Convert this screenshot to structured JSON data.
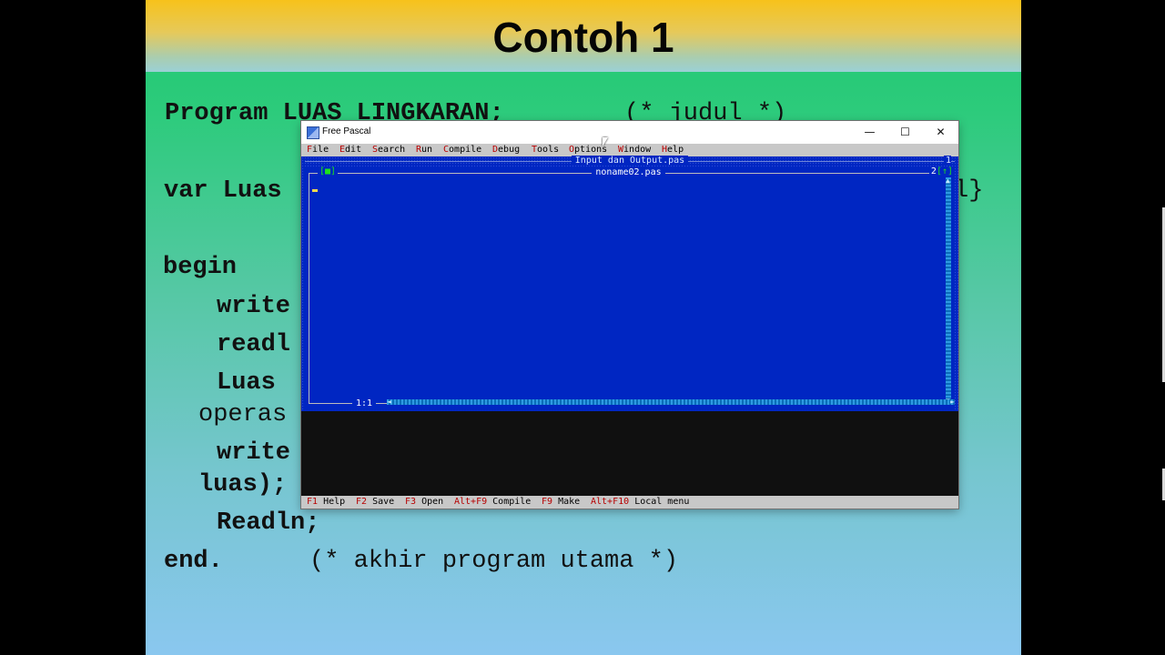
{
  "slide": {
    "title": "Contoh 1",
    "lines": {
      "program": "Program LUAS LINGKARAN;",
      "program_comment": "(* judul *)",
      "var": "var Luas",
      "var_tail": "l}",
      "begin": "begin",
      "write1": "write",
      "readln1": "readl",
      "luas_assign": "Luas",
      "operas": "operas",
      "write2": "write",
      "luas_close": "luas);",
      "readln2": "Readln;",
      "end": "end.",
      "end_comment": "(* akhir program utama *)"
    }
  },
  "window": {
    "title": "Free Pascal",
    "controls": {
      "minimize": "—",
      "maximize": "☐",
      "close": "✕"
    },
    "menu": [
      {
        "hotkey": "F",
        "rest": "ile"
      },
      {
        "hotkey": "E",
        "rest": "dit"
      },
      {
        "hotkey": "S",
        "rest": "earch"
      },
      {
        "hotkey": "R",
        "rest": "un"
      },
      {
        "hotkey": "C",
        "rest": "ompile"
      },
      {
        "hotkey": "D",
        "rest": "ebug"
      },
      {
        "hotkey": "T",
        "rest": "ools"
      },
      {
        "hotkey": "O",
        "rest": "ptions"
      },
      {
        "hotkey": "W",
        "rest": "indow"
      },
      {
        "hotkey": "H",
        "rest": "elp"
      }
    ],
    "back_editor": {
      "title": "Input dan Output.pas",
      "number": "1"
    },
    "editor": {
      "title": "noname02.pas",
      "close_box": "[■]",
      "number": "2",
      "zoom_box": "[↑]",
      "cursor_pos": "1:1"
    },
    "status": [
      {
        "key": "F1",
        "label": "Help"
      },
      {
        "key": "F2",
        "label": "Save"
      },
      {
        "key": "F3",
        "label": "Open"
      },
      {
        "key": "Alt+F9",
        "label": "Compile"
      },
      {
        "key": "F9",
        "label": "Make"
      },
      {
        "key": "Alt+F10",
        "label": "Local menu"
      }
    ]
  }
}
